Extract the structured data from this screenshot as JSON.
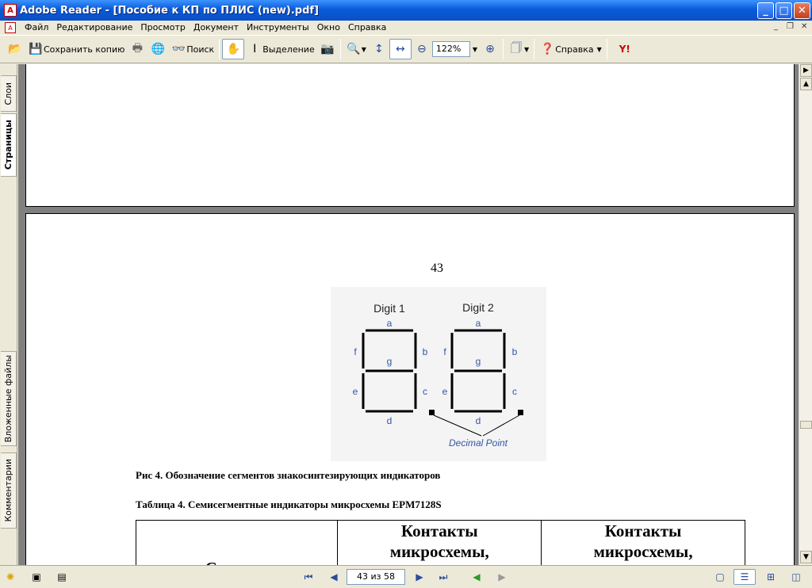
{
  "window": {
    "title": "Adobe Reader - [Пособие к КП по ПЛИС (new).pdf]",
    "app_icon": "adobe-reader-icon",
    "controls": [
      "minimize-icon",
      "maximize-icon",
      "close-icon"
    ]
  },
  "menu": {
    "items": [
      "Файл",
      "Редактирование",
      "Просмотр",
      "Документ",
      "Инструменты",
      "Окно",
      "Справка"
    ],
    "mdi_controls": [
      "minimize-doc-icon",
      "restore-doc-icon",
      "close-doc-icon"
    ]
  },
  "toolbar": {
    "save_copy": "Сохранить копию",
    "search": "Поиск",
    "select": "Выделение",
    "zoom_value": "122%",
    "help": "Справка"
  },
  "left_tabs": {
    "layers": "Слои",
    "pages": "Страницы",
    "attachments": "Вложенные файлы",
    "comments": "Комментарии"
  },
  "document": {
    "page_number": "43",
    "figure": {
      "digit1": "Digit 1",
      "digit2": "Digit 2",
      "segments": {
        "a": "a",
        "b": "b",
        "c": "c",
        "d": "d",
        "e": "e",
        "f": "f",
        "g": "g"
      },
      "decimal_point": "Decimal Point"
    },
    "caption": "Рис 4. Обозначение сегментов знакосинтезирующих индикаторов",
    "table_title": "Таблица 4. Семисегментные индикаторы микросхемы EPM7128S",
    "table_headers": [
      "Сегмент",
      "Контакты микросхемы,",
      "Контакты микросхемы,"
    ]
  },
  "status": {
    "page_indicator": "43 из 58"
  },
  "colors": {
    "titlebar": "#0a5ad8",
    "chrome": "#ece9d8",
    "viewport": "#808080",
    "segment_label": "#3355aa"
  }
}
